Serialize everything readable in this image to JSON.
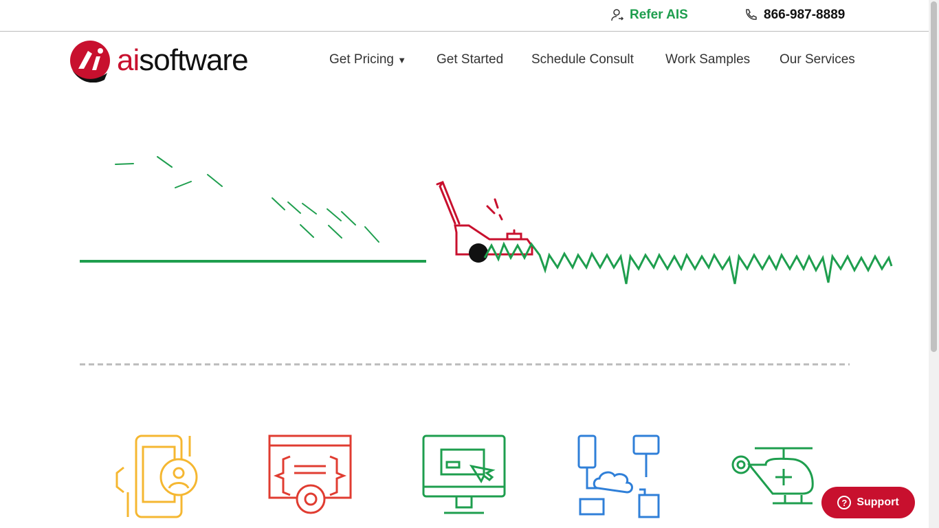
{
  "topbar": {
    "refer_label": "Refer AIS",
    "phone": "866-987-8889"
  },
  "logo": {
    "prefix": "ai",
    "suffix": "software"
  },
  "nav": [
    {
      "label": "Get Pricing"
    },
    {
      "label": "Get Started"
    },
    {
      "label": "Schedule Consult"
    },
    {
      "label": "Work Samples"
    },
    {
      "label": "Our Services"
    }
  ],
  "support": {
    "label": "Support"
  },
  "colors": {
    "green": "#1e9e4e",
    "red": "#c8102e",
    "yellow": "#f5b731",
    "blue": "#2f7fd8"
  },
  "service_icons": [
    "mobile-app-icon",
    "web-code-icon",
    "desktop-app-icon",
    "cloud-network-icon",
    "helicopter-icon"
  ]
}
